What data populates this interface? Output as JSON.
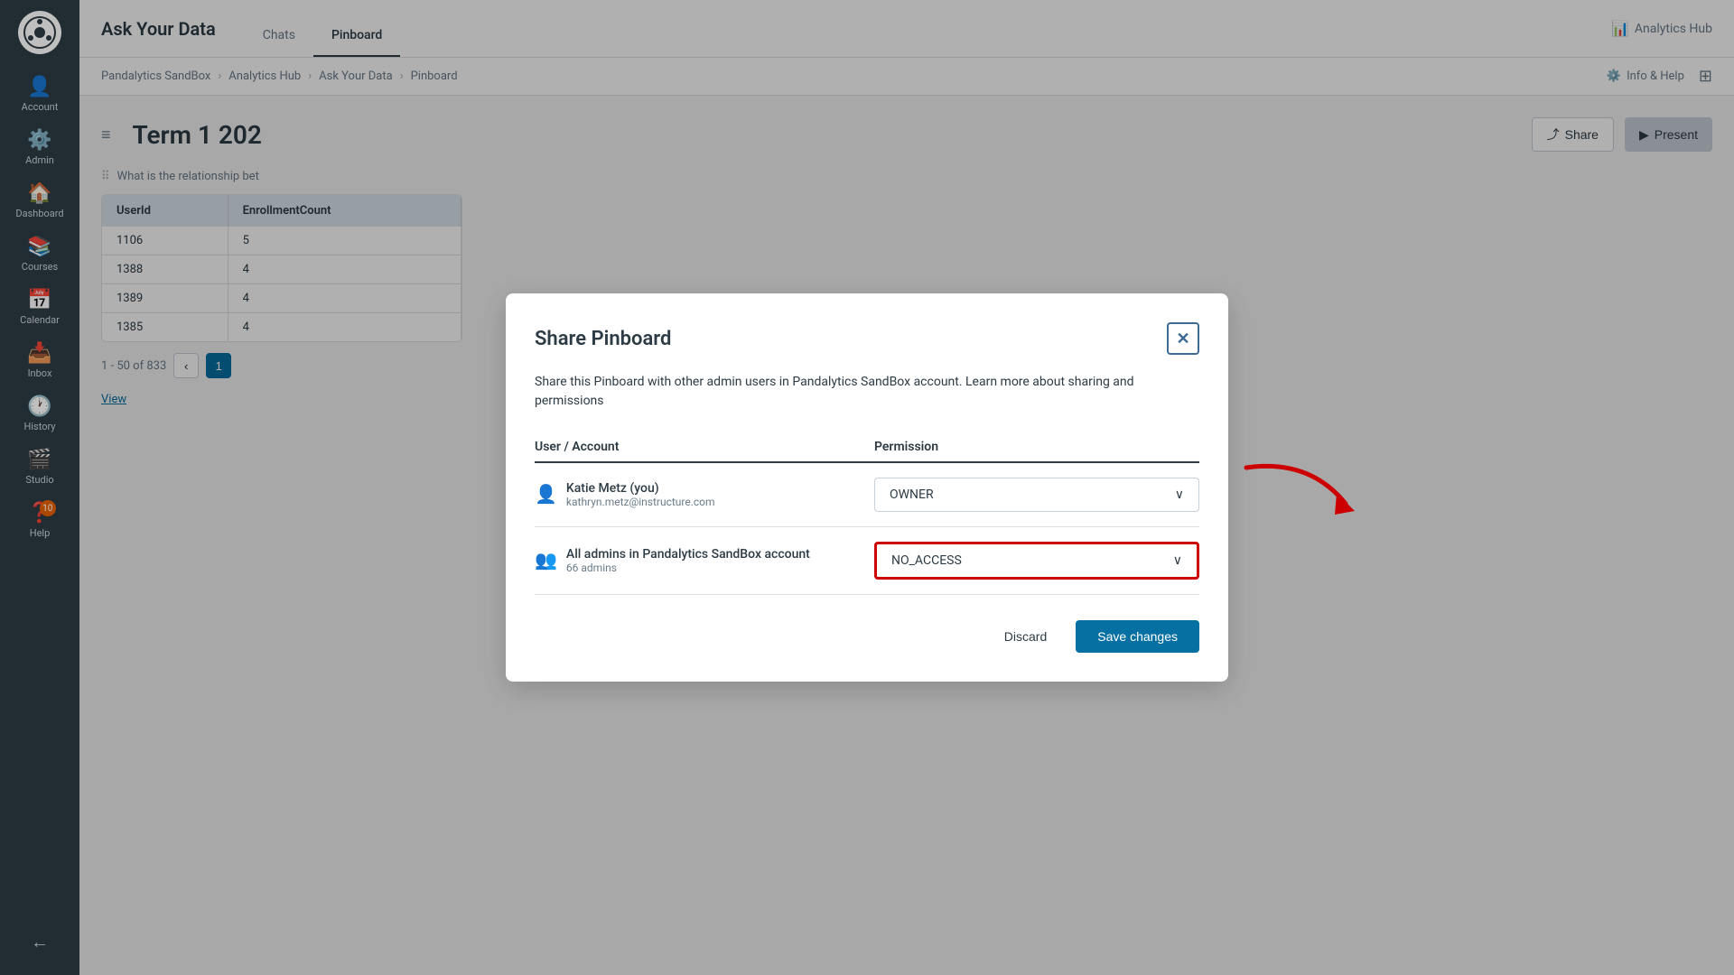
{
  "sidebar": {
    "items": [
      {
        "id": "account",
        "label": "Account",
        "icon": "👤"
      },
      {
        "id": "admin",
        "label": "Admin",
        "icon": "⚙️"
      },
      {
        "id": "dashboard",
        "label": "Dashboard",
        "icon": "🏠"
      },
      {
        "id": "courses",
        "label": "Courses",
        "icon": "📚"
      },
      {
        "id": "calendar",
        "label": "Calendar",
        "icon": "📅"
      },
      {
        "id": "inbox",
        "label": "Inbox",
        "icon": "📥"
      },
      {
        "id": "history",
        "label": "History",
        "icon": "🕐"
      },
      {
        "id": "studio",
        "label": "Studio",
        "icon": "🎬"
      },
      {
        "id": "help",
        "label": "Help",
        "icon": "❓",
        "badge": "10"
      }
    ],
    "collapse_icon": "←"
  },
  "topbar": {
    "title": "Ask Your Data",
    "tabs": [
      {
        "id": "chats",
        "label": "Chats",
        "active": false
      },
      {
        "id": "pinboard",
        "label": "Pinboard",
        "active": true
      }
    ],
    "analytics_hub_label": "Analytics Hub"
  },
  "breadcrumb": {
    "items": [
      "Pandalytics SandBox",
      "Analytics Hub",
      "Ask Your Data",
      "Pinboard"
    ],
    "info_help_label": "Info & Help"
  },
  "page": {
    "title": "Term 1 202",
    "query_text": "What is the relationship bet",
    "share_label": "Share",
    "present_label": "Present"
  },
  "table": {
    "columns": [
      "UserId",
      "EnrollmentCount"
    ],
    "rows": [
      {
        "userid": "1106",
        "count": "5"
      },
      {
        "userid": "1388",
        "count": "4"
      },
      {
        "userid": "1389",
        "count": "4"
      },
      {
        "userid": "1385",
        "count": "4"
      }
    ],
    "pagination": {
      "summary": "1 - 50 of 833",
      "current_page": "1"
    },
    "view_label": "View"
  },
  "modal": {
    "title": "Share Pinboard",
    "description": "Share this Pinboard with other admin users in Pandalytics SandBox account. Learn more about sharing and permissions",
    "columns": {
      "user_account": "User / Account",
      "permission": "Permission"
    },
    "users": [
      {
        "name": "Katie Metz (you)",
        "email": "kathryn.metz@instructure.com",
        "permission": "OWNER",
        "highlighted": false
      },
      {
        "name": "All admins in Pandalytics SandBox account",
        "sub": "66 admins",
        "permission": "NO_ACCESS",
        "highlighted": true
      }
    ],
    "discard_label": "Discard",
    "save_label": "Save changes"
  }
}
